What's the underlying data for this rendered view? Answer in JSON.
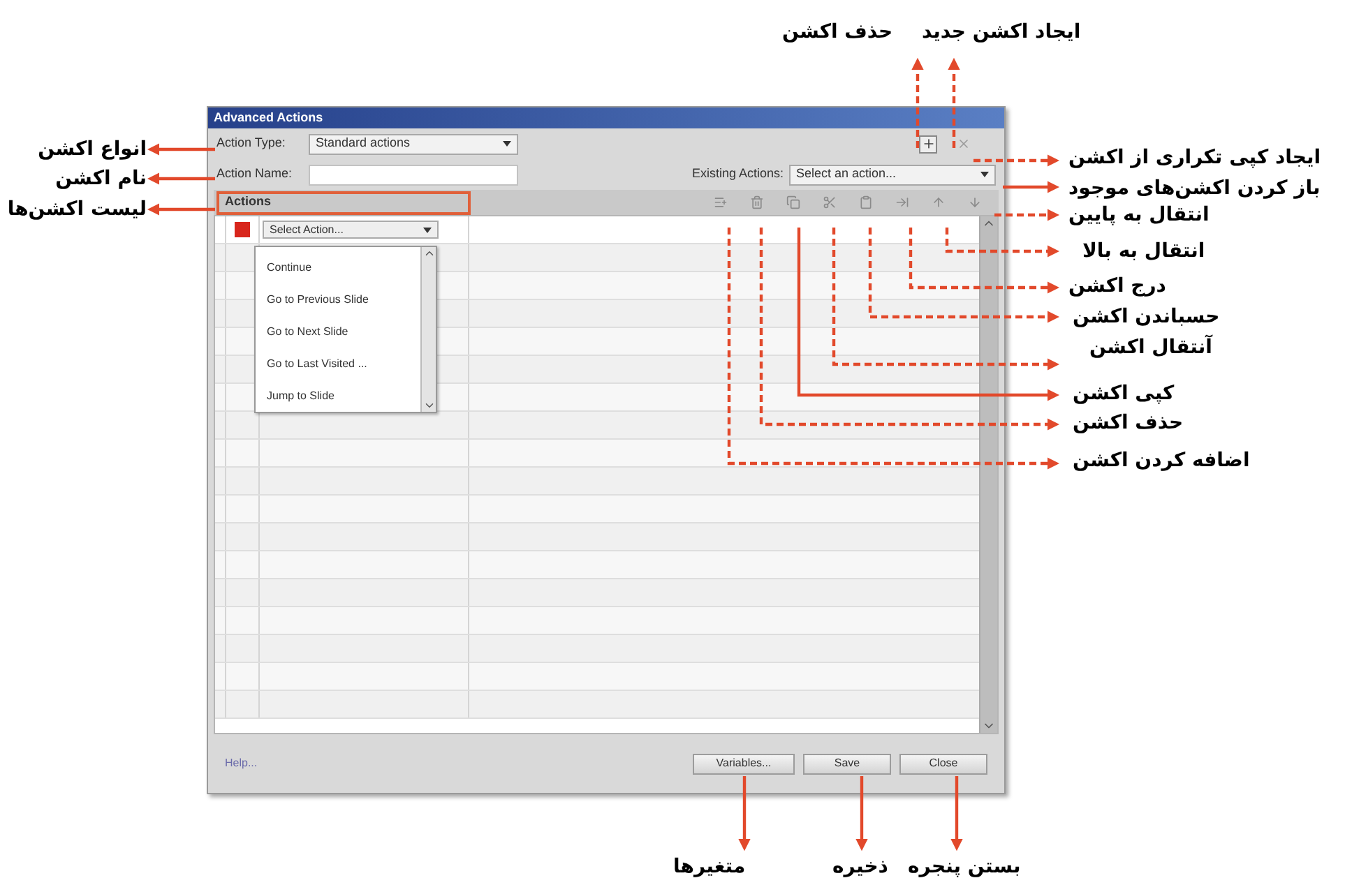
{
  "window": {
    "title": "Advanced Actions"
  },
  "action_type": {
    "label": "Action Type:",
    "value": "Standard actions"
  },
  "action_name": {
    "label": "Action Name:"
  },
  "existing_actions": {
    "label": "Existing Actions:",
    "value": "Select an action..."
  },
  "actions_header": "Actions",
  "first_row": {
    "select": "Select Action..."
  },
  "action_menu": {
    "items": [
      "Continue",
      "Go to Previous Slide",
      "Go to Next Slide",
      "Go to Last Visited ...",
      "Jump to Slide"
    ]
  },
  "help_link": "Help...",
  "variables_button": "Variables...",
  "save_button": "Save",
  "close_button": "Close",
  "callouts": [
    {
      "text": "حذف اکشن"
    },
    {
      "text": "ایجاد اکشن جدید"
    },
    {
      "text": "ایجاد کپی تکراری از اکشن"
    },
    {
      "text": "باز کردن اکشن‌های موجود"
    },
    {
      "text": "انتقال به پایین"
    },
    {
      "text": "انتقال به بالا"
    },
    {
      "text": "درج اکشن"
    },
    {
      "text": "حسباندن اکشن"
    },
    {
      "text": "آنتقال اکشن"
    },
    {
      "text": "کپی اکشن"
    },
    {
      "text": "حذف اکشن"
    },
    {
      "text": "اضافه کردن اکشن"
    },
    {
      "text": "انواع اکشن"
    },
    {
      "text": "نام اکشن"
    },
    {
      "text": "لیست اکشن‌ها"
    },
    {
      "text": "بستن پنجره"
    },
    {
      "text": "ذخیره"
    },
    {
      "text": "متغیرها"
    }
  ]
}
